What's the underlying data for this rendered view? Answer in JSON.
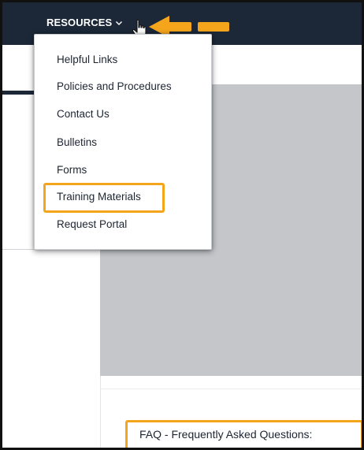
{
  "nav": {
    "resources_label": "RESOURCES"
  },
  "dropdown": {
    "items": [
      {
        "label": "Helpful Links"
      },
      {
        "label": "Policies and Procedures"
      },
      {
        "label": "Contact Us"
      },
      {
        "label": "Bulletins"
      },
      {
        "label": "Forms"
      },
      {
        "label": "Training Materials"
      },
      {
        "label": "Request Portal"
      }
    ]
  },
  "main": {
    "faq_label": "FAQ - Frequently Asked Questions:"
  },
  "colors": {
    "navbar": "#1c2838",
    "highlight": "#f4a51c",
    "placeholder": "#c4c6ca"
  },
  "icons": {
    "chevron": "chevron-down-icon",
    "cursor": "hand-pointer-icon",
    "arrow": "arrow-left-icon"
  }
}
